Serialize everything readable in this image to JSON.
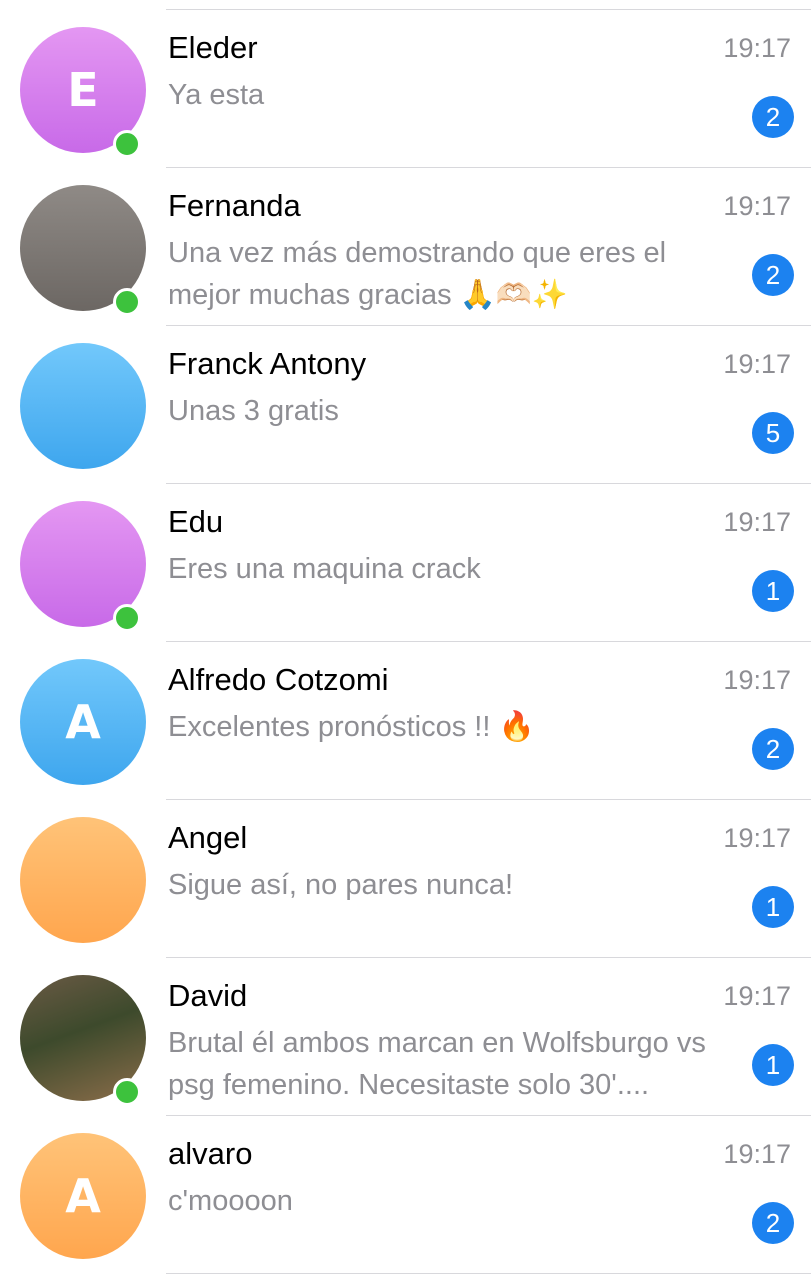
{
  "chats": [
    {
      "name": "Eleder",
      "time": "19:17",
      "message": "Ya esta",
      "unread": "2",
      "avatar_initial": "E",
      "avatar_color": "purple",
      "online": true
    },
    {
      "name": "Fernanda",
      "time": "19:17",
      "message": "Una vez más demostrando que eres el mejor muchas gracias 🙏🫶🏻✨",
      "unread": "2",
      "avatar_initial": "",
      "avatar_color": "grey",
      "online": true
    },
    {
      "name": "Franck Antony",
      "time": "19:17",
      "message": "Unas 3 gratis",
      "unread": "5",
      "avatar_initial": "",
      "avatar_color": "blue",
      "online": false
    },
    {
      "name": "Edu",
      "time": "19:17",
      "message": "Eres una maquina crack",
      "unread": "1",
      "avatar_initial": "",
      "avatar_color": "purple",
      "online": true
    },
    {
      "name": "Alfredo Cotzomi",
      "time": "19:17",
      "message": "Excelentes pronósticos !! 🔥",
      "unread": "2",
      "avatar_initial": "A",
      "avatar_color": "blue",
      "online": false
    },
    {
      "name": "Angel",
      "time": "19:17",
      "message": "Sigue así, no pares nunca!",
      "unread": "1",
      "avatar_initial": "",
      "avatar_color": "orange",
      "online": false
    },
    {
      "name": "David",
      "time": "19:17",
      "message": "Brutal él ambos marcan en Wolfsburgo vs psg femenino. Necesitaste solo 30'....",
      "unread": "1",
      "avatar_initial": "",
      "avatar_color": "photo",
      "online": true
    },
    {
      "name": "alvaro",
      "time": "19:17",
      "message": "c'moooon",
      "unread": "2",
      "avatar_initial": "A",
      "avatar_color": "orange",
      "online": false
    }
  ]
}
